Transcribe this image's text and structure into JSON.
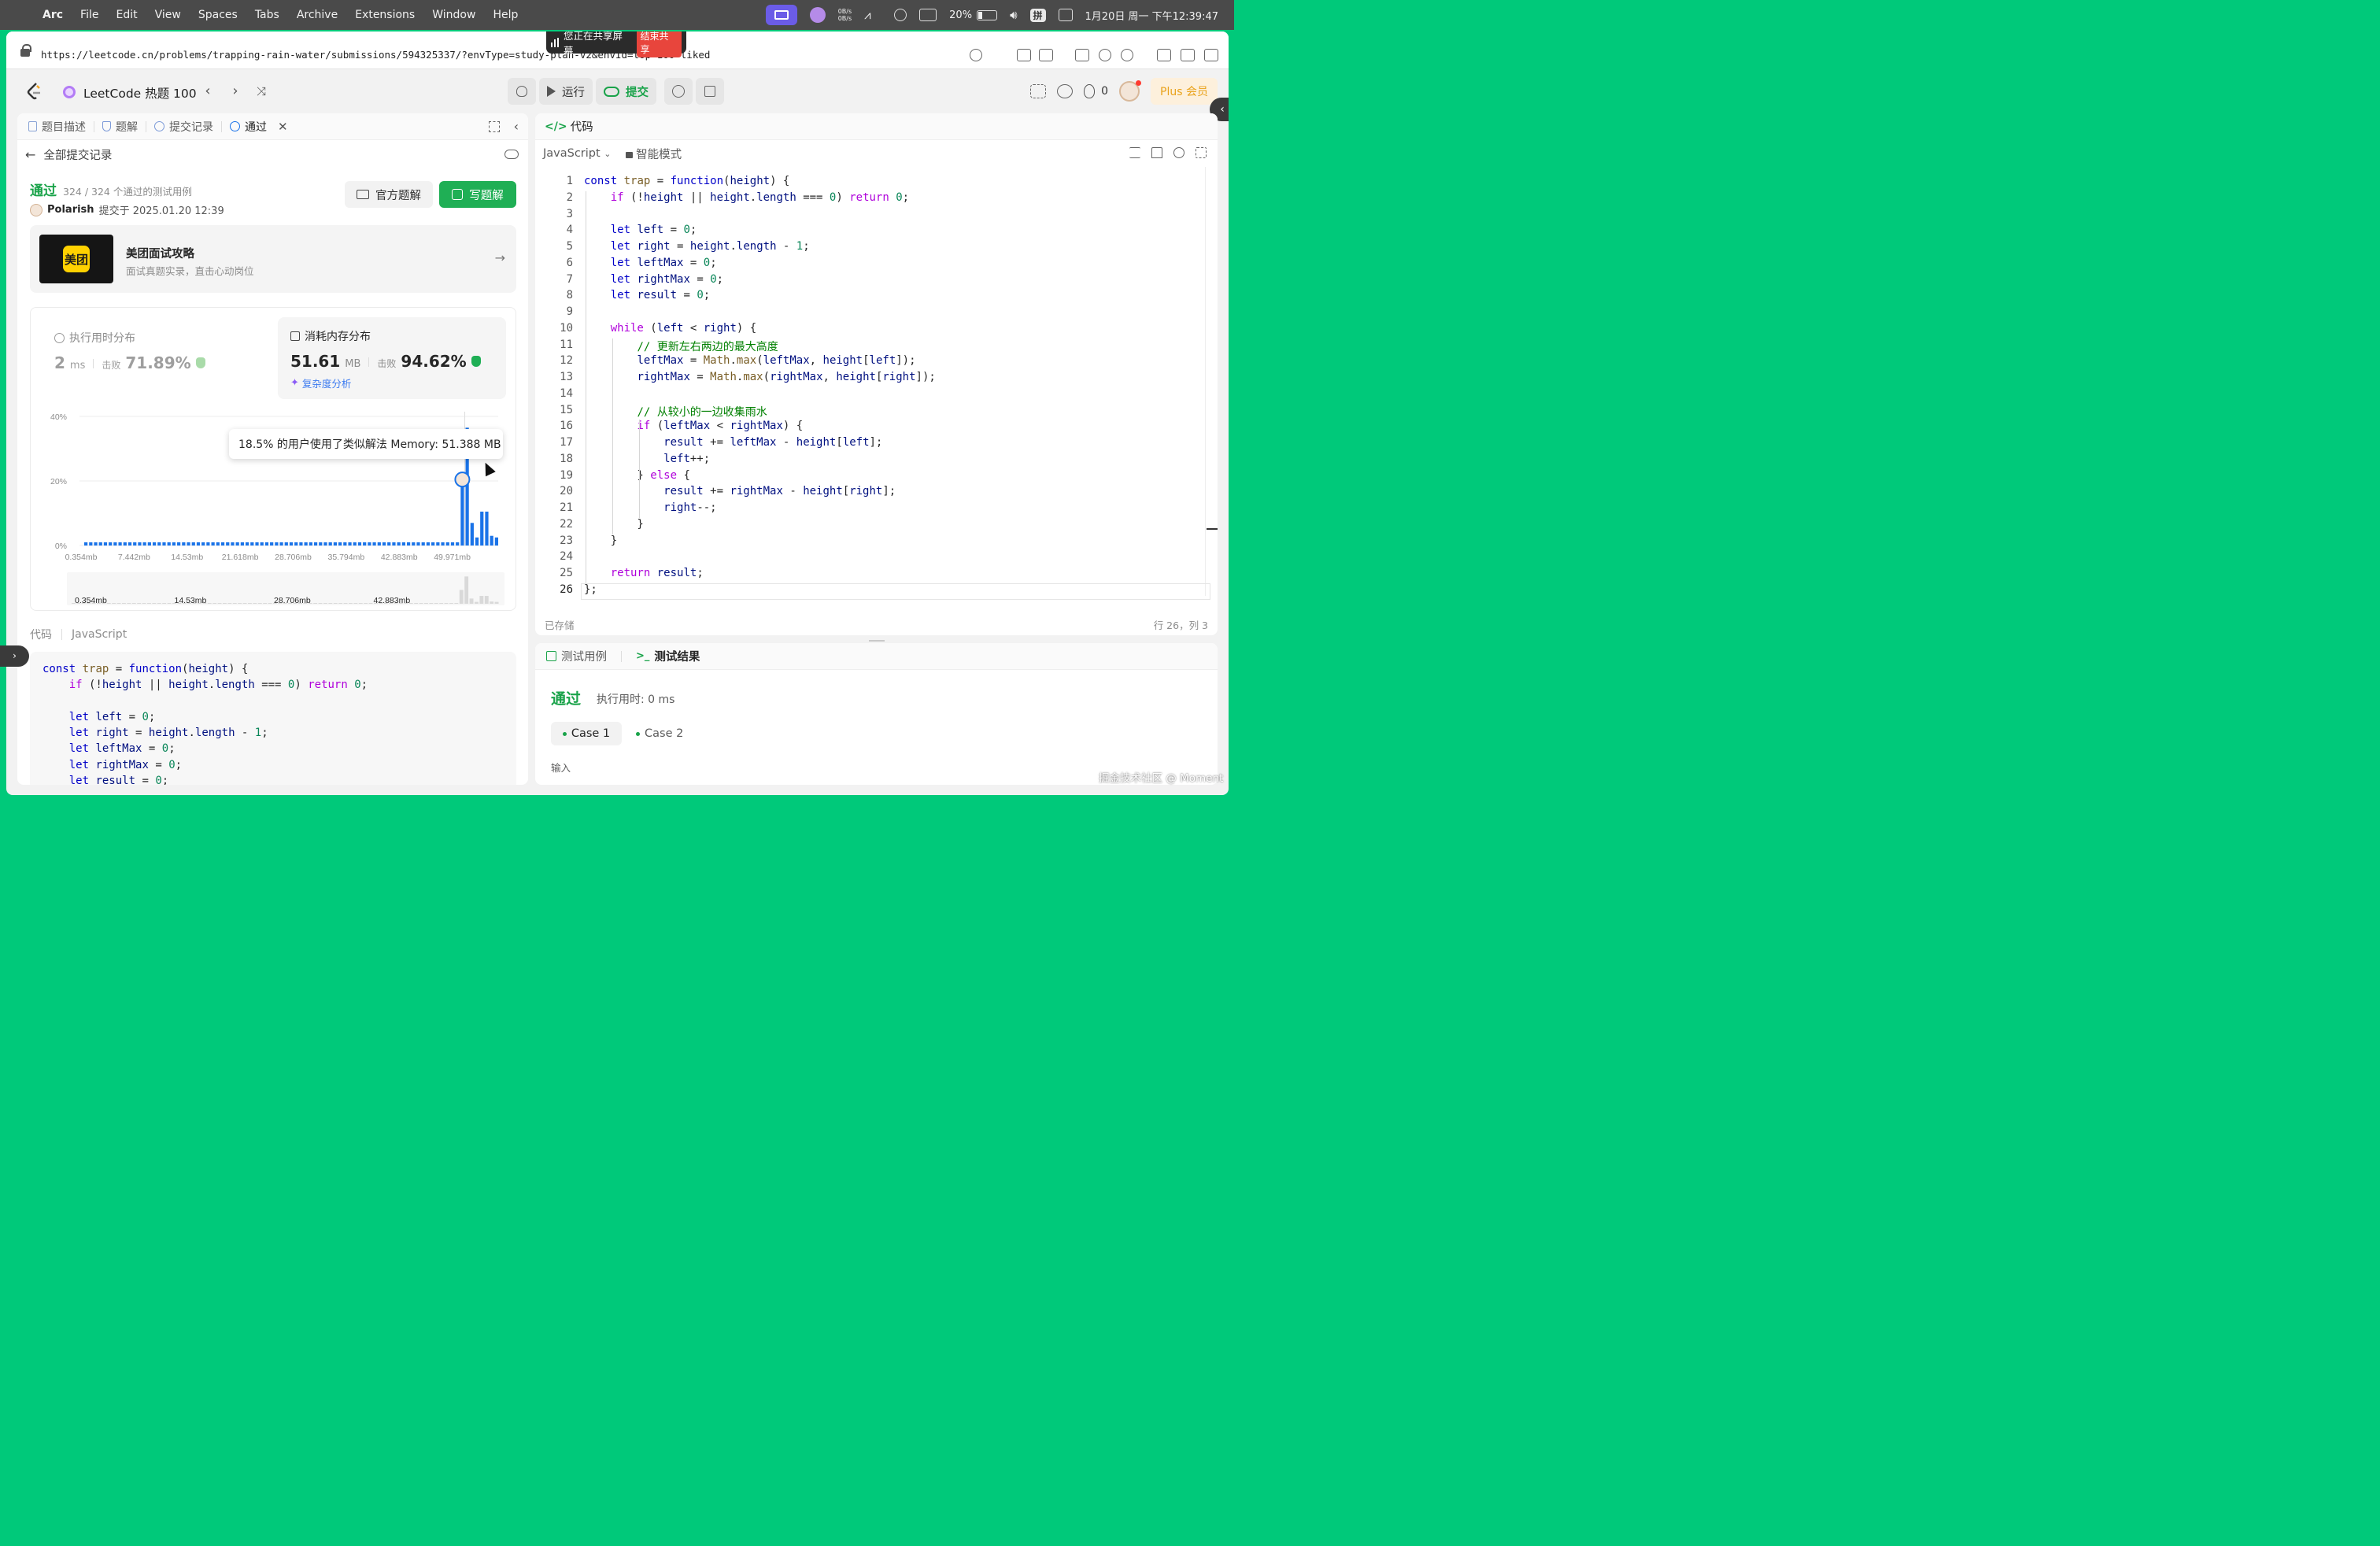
{
  "menubar": {
    "app": "Arc",
    "items": [
      "File",
      "Edit",
      "View",
      "Spaces",
      "Tabs",
      "Archive",
      "Extensions",
      "Window",
      "Help"
    ],
    "battery": "20%",
    "input_method": "拼",
    "clock": "1月20日 周一  下午12:39:47",
    "net_up": "0B/s",
    "net_down": "0B/s"
  },
  "browser": {
    "url": "https://leetcode.cn/problems/trapping-rain-water/submissions/594325337/?envType=study-plan-v2&envId=top-100-liked",
    "share_banner": "您正在共享屏幕",
    "stop_share": "结束共享"
  },
  "toolbar": {
    "study_plan_title": "LeetCode 热题 100",
    "run_label": "运行",
    "submit_label": "提交",
    "streak_count": "0",
    "plus_label": "Plus 会员"
  },
  "left": {
    "tabs": [
      "题目描述",
      "题解",
      "提交记录",
      "通过"
    ],
    "back_label": "全部提交记录",
    "status": "通过",
    "testcases": "324 / 324 个通过的测试用例",
    "user": "Polarish",
    "submitted_at": "提交于 2025.01.20 12:39",
    "official_solution": "官方题解",
    "write_solution": "写题解",
    "ad": {
      "logo": "美团",
      "title": "美团面试攻略",
      "subtitle": "面试真题实录，直击心动岗位"
    },
    "runtime": {
      "title": "执行用时分布",
      "value": "2",
      "unit": "ms",
      "beat_label": "击败",
      "beat": "71.89%"
    },
    "memory": {
      "title": "消耗内存分布",
      "value": "51.61",
      "unit": "MB",
      "beat_label": "击败",
      "beat": "94.62%",
      "complexity_link": "复杂度分析"
    },
    "tooltip": "18.5% 的用户使用了类似解法 Memory: 51.388 MB",
    "code_label": "代码",
    "code_lang": "JavaScript"
  },
  "chart_data": {
    "type": "bar",
    "title": "",
    "xlabel": "",
    "ylabel": "",
    "ylim": [
      0,
      40
    ],
    "yticks": [
      "0%",
      "20%",
      "40%"
    ],
    "xticks": [
      "0.354mb",
      "7.442mb",
      "14.53mb",
      "21.618mb",
      "28.706mb",
      "35.794mb",
      "42.883mb",
      "49.971mb"
    ],
    "navigator_ticks": [
      "0.354mb",
      "14.53mb",
      "28.706mb",
      "42.883mb"
    ],
    "bar_count": 50,
    "values": [
      1,
      1,
      1,
      1,
      1,
      1,
      1,
      1,
      1,
      1,
      1,
      1,
      1,
      1,
      1,
      1,
      1,
      1,
      1,
      1,
      1,
      1,
      1,
      1,
      1,
      1,
      1,
      1,
      1,
      1,
      1,
      1,
      1,
      1,
      1,
      1,
      1,
      1,
      1,
      1,
      1,
      1,
      1,
      1,
      1,
      1,
      1,
      1,
      1,
      1,
      1,
      1,
      1,
      1,
      1,
      1,
      1,
      1,
      1,
      1,
      1,
      1,
      1,
      1,
      1,
      1,
      1,
      1,
      1,
      1,
      1,
      1,
      1,
      1,
      1,
      1,
      1,
      18.5,
      36.5,
      7,
      2.5,
      10.5,
      10.5,
      3,
      2.5
    ],
    "highlight_index": 77,
    "highlight_value": 18.5,
    "color": "#1a73e8"
  },
  "editor": {
    "title": "代码",
    "language": "JavaScript",
    "mode": "智能模式",
    "saved": "已存储",
    "cursor_pos": "行 26，列 3",
    "active_line": 26
  },
  "code_lines": [
    "const trap = function(height) {",
    "    if (!height || height.length === 0) return 0;",
    "",
    "    let left = 0;",
    "    let right = height.length - 1;",
    "    let leftMax = 0;",
    "    let rightMax = 0;",
    "    let result = 0;",
    "",
    "    while (left < right) {",
    "        // 更新左右两边的最大高度",
    "        leftMax = Math.max(leftMax, height[left]);",
    "        rightMax = Math.max(rightMax, height[right]);",
    "",
    "        // 从较小的一边收集雨水",
    "        if (leftMax < rightMax) {",
    "            result += leftMax - height[left];",
    "            left++;",
    "        } else {",
    "            result += rightMax - height[right];",
    "            right--;",
    "        }",
    "    }",
    "",
    "    return result;",
    "};"
  ],
  "test": {
    "tabs": [
      "测试用例",
      "测试结果"
    ],
    "status": "通过",
    "runtime": "执行用时: 0 ms",
    "cases": [
      "Case 1",
      "Case 2"
    ],
    "input_label": "输入"
  },
  "watermark": "掘金技术社区 @ Moment"
}
